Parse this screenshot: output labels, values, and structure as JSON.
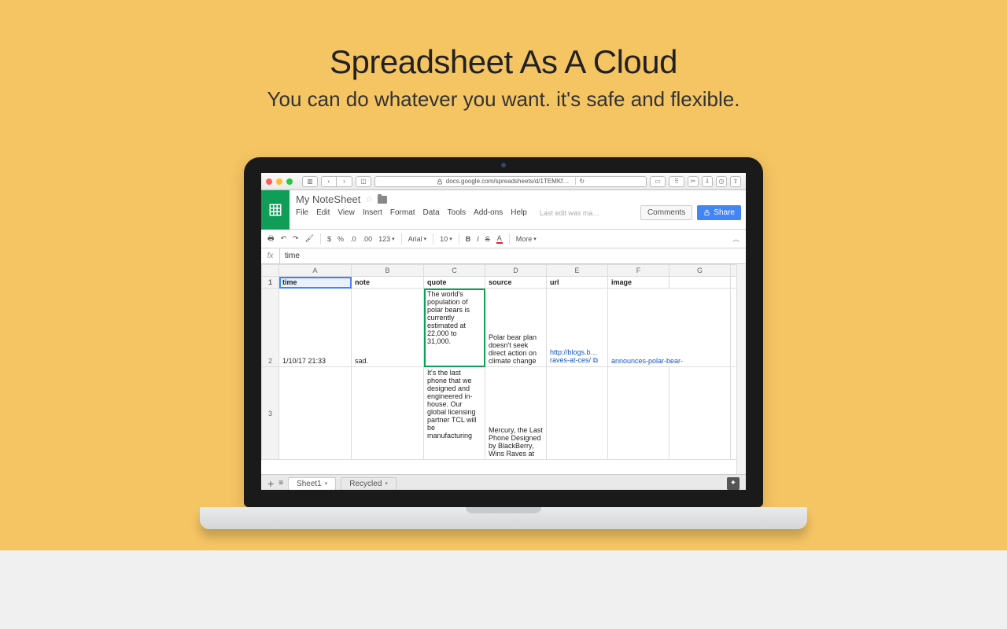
{
  "hero": {
    "title": "Spreadsheet As A Cloud",
    "subtitle": "You can do whatever you want. it's safe and flexible."
  },
  "safari": {
    "url": "docs.google.com/spreadsheets/d/1TEMKf…",
    "reload": "↻"
  },
  "sheets": {
    "doc_title": "My NoteSheet",
    "menus": [
      "File",
      "Edit",
      "View",
      "Insert",
      "Format",
      "Data",
      "Tools",
      "Add-ons",
      "Help"
    ],
    "last_edit": "Last edit was ma…",
    "comments": "Comments",
    "share": "Share"
  },
  "toolbar": {
    "font": "Arial",
    "size": "10",
    "more": "More",
    "num_labels": [
      "$",
      "%",
      ".0",
      ".00",
      "123"
    ]
  },
  "fx": {
    "label": "fx",
    "value": "time"
  },
  "columns": [
    "",
    "A",
    "B",
    "C",
    "D",
    "E",
    "F",
    "G"
  ],
  "headers": [
    "time",
    "note",
    "quote",
    "source",
    "url",
    "image"
  ],
  "rows": [
    {
      "n": "2",
      "time": "1/10/17 21:33",
      "note": "sad.",
      "quote": "The world's population of polar bears is currently estimated at 22,000 to 31,000.",
      "source": "Polar bear plan doesn't seek direct action on climate change",
      "url": "http://blogs.b…raves-at-ces/",
      "image": "announces-polar-bear-"
    },
    {
      "n": "3",
      "time": "",
      "note": "",
      "quote": "It's the last phone that we designed and engineered in-house. Our global licensing partner TCL will be manufacturing",
      "source": "Mercury, the Last Phone Designed by BlackBerry, Wins Raves at",
      "url": "",
      "image": ""
    }
  ],
  "sheet_tabs": {
    "plus": "+",
    "active": "Sheet1",
    "second": "Recycled"
  }
}
